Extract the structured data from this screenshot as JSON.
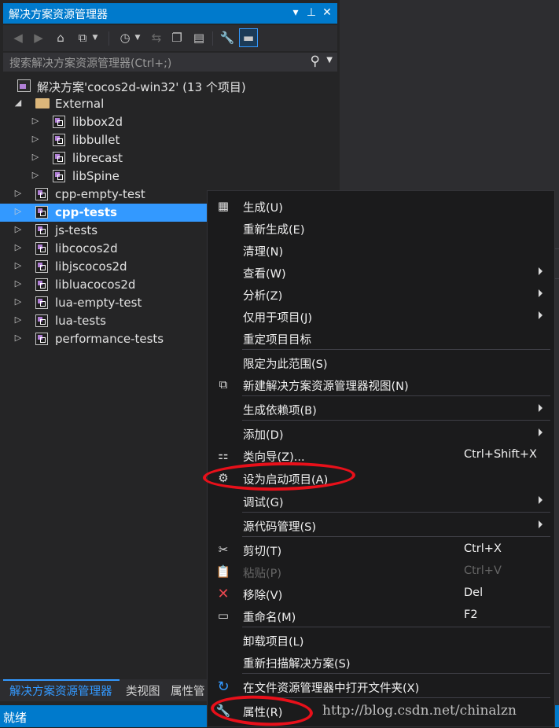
{
  "window": {
    "title": "解决方案资源管理器",
    "title_buttons": [
      "▾",
      "⊥",
      "✕"
    ]
  },
  "toolbar": {
    "icons": [
      "back-icon",
      "forward-icon",
      "home-icon",
      "switch-views-icon",
      "dropdown-icon",
      "pending-changes-filter-icon",
      "dropdown-icon",
      "sync-icon",
      "collapse-all-icon",
      "show-all-files-icon",
      "properties-wrench-icon",
      "preview-selected-icon"
    ]
  },
  "search": {
    "placeholder": "搜索解决方案资源管理器(Ctrl+;)"
  },
  "tree": {
    "solution_label": "解决方案'cocos2d-win32' (13 个项目)",
    "external_label": "External",
    "external_items": [
      "libbox2d",
      "libbullet",
      "librecast",
      "libSpine"
    ],
    "projects": [
      "cpp-empty-test",
      "cpp-tests",
      "js-tests",
      "libcocos2d",
      "libjscocos2d",
      "libluacocos2d",
      "lua-empty-test",
      "lua-tests",
      "performance-tests"
    ],
    "selected": "cpp-tests"
  },
  "bottom_tabs": [
    "解决方案资源管理器",
    "类视图",
    "属性管"
  ],
  "status": {
    "text": "就绪"
  },
  "context_menu": {
    "items": [
      {
        "label": "生成(U)",
        "shortcut": "",
        "icon": "build-icon",
        "submenu": false
      },
      {
        "label": "重新生成(E)",
        "shortcut": "",
        "icon": "",
        "submenu": false
      },
      {
        "label": "清理(N)",
        "shortcut": "",
        "icon": "",
        "submenu": false
      },
      {
        "label": "查看(W)",
        "shortcut": "",
        "icon": "",
        "submenu": true
      },
      {
        "label": "分析(Z)",
        "shortcut": "",
        "icon": "",
        "submenu": true
      },
      {
        "label": "仅用于项目(J)",
        "shortcut": "",
        "icon": "",
        "submenu": true
      },
      {
        "label": "重定项目目标",
        "shortcut": "",
        "icon": "",
        "submenu": false
      },
      {
        "label": "限定为此范围(S)",
        "shortcut": "",
        "icon": "",
        "submenu": false
      },
      {
        "label": "新建解决方案资源管理器视图(N)",
        "shortcut": "",
        "icon": "new-view-icon",
        "submenu": false
      },
      {
        "label": "生成依赖项(B)",
        "shortcut": "",
        "icon": "",
        "submenu": true
      },
      {
        "label": "添加(D)",
        "shortcut": "",
        "icon": "",
        "submenu": true
      },
      {
        "label": "类向导(Z)...",
        "shortcut": "Ctrl+Shift+X",
        "icon": "class-wizard-icon",
        "submenu": false
      },
      {
        "label": "设为启动项目(A)",
        "shortcut": "",
        "icon": "gear-icon",
        "submenu": false
      },
      {
        "label": "调试(G)",
        "shortcut": "",
        "icon": "",
        "submenu": true
      },
      {
        "label": "源代码管理(S)",
        "shortcut": "",
        "icon": "",
        "submenu": true
      },
      {
        "label": "剪切(T)",
        "shortcut": "Ctrl+X",
        "icon": "scissors-icon",
        "submenu": false
      },
      {
        "label": "粘贴(P)",
        "shortcut": "Ctrl+V",
        "icon": "paste-icon",
        "submenu": false,
        "disabled": true
      },
      {
        "label": "移除(V)",
        "shortcut": "Del",
        "icon": "remove-icon",
        "submenu": false
      },
      {
        "label": "重命名(M)",
        "shortcut": "F2",
        "icon": "rename-icon",
        "submenu": false
      },
      {
        "label": "卸载项目(L)",
        "shortcut": "",
        "icon": "",
        "submenu": false
      },
      {
        "label": "重新扫描解决方案(S)",
        "shortcut": "",
        "icon": "",
        "submenu": false
      },
      {
        "label": "在文件资源管理器中打开文件夹(X)",
        "shortcut": "",
        "icon": "open-folder-refresh-icon",
        "submenu": false
      },
      {
        "label": "属性(R)",
        "shortcut": "",
        "icon": "wrench-icon",
        "submenu": false
      }
    ],
    "highlighted": [
      "设为启动项目(A)",
      "属性(R)"
    ],
    "highlight_color": "#e8101a"
  },
  "watermark": "http://blog.csdn.net/chinalzn",
  "colors": {
    "accent": "#007acc",
    "selection": "#3399ff",
    "panel_bg": "#252526",
    "menu_bg": "#1b1b1c"
  }
}
